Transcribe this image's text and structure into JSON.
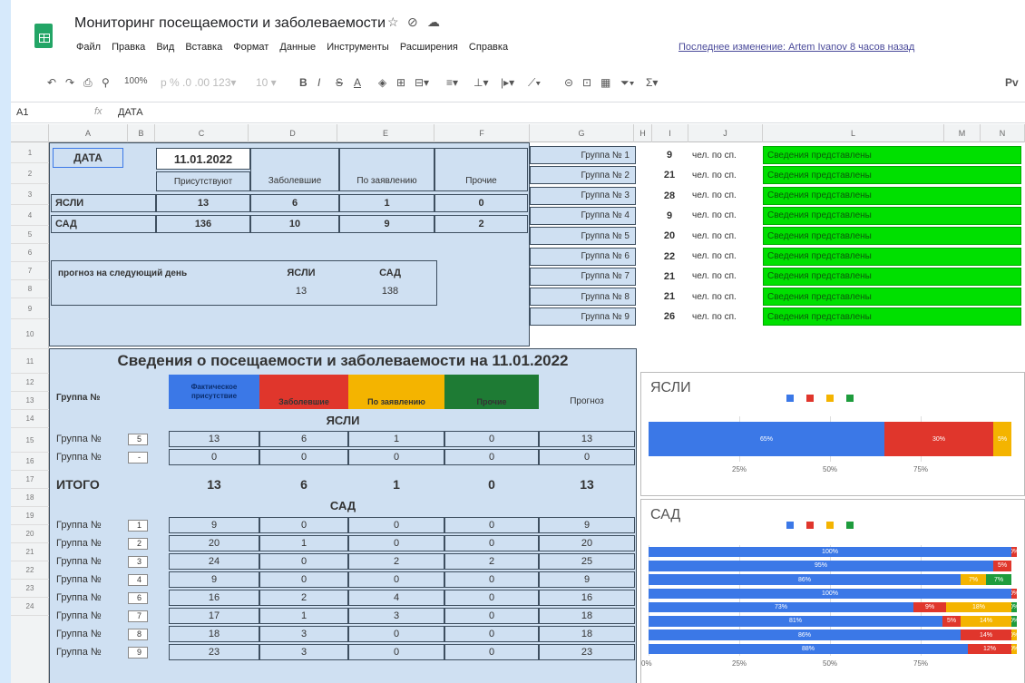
{
  "title": "Мониторинг посещаемости и заболеваемости",
  "menu": [
    "Файл",
    "Правка",
    "Вид",
    "Вставка",
    "Формат",
    "Данные",
    "Инструменты",
    "Расширения",
    "Справка"
  ],
  "last_edit": "Последнее изменение: Artem Ivanov 8 часов назад",
  "toolbar": {
    "zoom": "100%",
    "font": "Pv"
  },
  "formula": {
    "cell": "A1",
    "fx": "fx",
    "value": "ДАТА"
  },
  "columns": [
    "A",
    "B",
    "C",
    "D",
    "E",
    "F",
    "G",
    "H",
    "I",
    "J",
    "L",
    "M",
    "N"
  ],
  "rows": [
    "1",
    "2",
    "3",
    "4",
    "5",
    "6",
    "7",
    "8",
    "9",
    "10",
    "11",
    "12",
    "13",
    "14",
    "15",
    "16",
    "17",
    "18",
    "19",
    "20",
    "21",
    "22",
    "23",
    "24"
  ],
  "top": {
    "date_label": "ДАТА",
    "date": "11.01.2022",
    "h_present": "Присутствуют",
    "h_sick": "Заболевшие",
    "h_request": "По заявлению",
    "h_other": "Прочие",
    "nursery": {
      "label": "ЯСЛИ",
      "present": "13",
      "sick": "6",
      "request": "1",
      "other": "0"
    },
    "kinder": {
      "label": "САД",
      "present": "136",
      "sick": "10",
      "request": "9",
      "other": "2"
    },
    "forecast_label": "прогноз на следующий день",
    "forecast_n_label": "ЯСЛИ",
    "forecast_n": "13",
    "forecast_k_label": "САД",
    "forecast_k": "138"
  },
  "groups": [
    {
      "name": "Группа № 1",
      "n": "9",
      "unit": "чел. по сп.",
      "status": "Сведения представлены"
    },
    {
      "name": "Группа № 2",
      "n": "21",
      "unit": "чел. по сп.",
      "status": "Сведения представлены"
    },
    {
      "name": "Группа № 3",
      "n": "28",
      "unit": "чел. по сп.",
      "status": "Сведения представлены"
    },
    {
      "name": "Группа № 4",
      "n": "9",
      "unit": "чел. по сп.",
      "status": "Сведения представлены"
    },
    {
      "name": "Группа № 5",
      "n": "20",
      "unit": "чел. по сп.",
      "status": "Сведения представлены"
    },
    {
      "name": "Группа № 6",
      "n": "22",
      "unit": "чел. по сп.",
      "status": "Сведения представлены"
    },
    {
      "name": "Группа № 7",
      "n": "21",
      "unit": "чел. по сп.",
      "status": "Сведения представлены"
    },
    {
      "name": "Группа № 8",
      "n": "21",
      "unit": "чел. по сп.",
      "status": "Сведения представлены"
    },
    {
      "name": "Группа № 9",
      "n": "26",
      "unit": "чел. по сп.",
      "status": "Сведения представлены"
    }
  ],
  "table": {
    "title": "Сведения о посещаемости и заболеваемости на 11.01.2022",
    "h_group": "Группа №",
    "h_actual": "Фактическое присутствие",
    "h_sick": "Заболевшие",
    "h_request": "По заявлению",
    "h_other": "Прочие",
    "h_forecast": "Прогноз",
    "colors": {
      "actual": "#3b78e7",
      "sick": "#e0362c",
      "request": "#f4b400",
      "other": "#1e7b34"
    },
    "nursery_label": "ЯСЛИ",
    "nursery_rows": [
      {
        "label": "Группа №",
        "num": "5",
        "actual": "13",
        "sick": "6",
        "request": "1",
        "other": "0",
        "forecast": "13"
      },
      {
        "label": "Группа №",
        "num": "-",
        "actual": "0",
        "sick": "0",
        "request": "0",
        "other": "0",
        "forecast": "0"
      }
    ],
    "total": {
      "label": "ИТОГО",
      "actual": "13",
      "sick": "6",
      "request": "1",
      "other": "0",
      "forecast": "13"
    },
    "kinder_label": "САД",
    "kinder_rows": [
      {
        "label": "Группа №",
        "num": "1",
        "actual": "9",
        "sick": "0",
        "request": "0",
        "other": "0",
        "forecast": "9"
      },
      {
        "label": "Группа №",
        "num": "2",
        "actual": "20",
        "sick": "1",
        "request": "0",
        "other": "0",
        "forecast": "20"
      },
      {
        "label": "Группа №",
        "num": "3",
        "actual": "24",
        "sick": "0",
        "request": "2",
        "other": "2",
        "forecast": "25"
      },
      {
        "label": "Группа №",
        "num": "4",
        "actual": "9",
        "sick": "0",
        "request": "0",
        "other": "0",
        "forecast": "9"
      },
      {
        "label": "Группа №",
        "num": "6",
        "actual": "16",
        "sick": "2",
        "request": "4",
        "other": "0",
        "forecast": "16"
      },
      {
        "label": "Группа №",
        "num": "7",
        "actual": "17",
        "sick": "1",
        "request": "3",
        "other": "0",
        "forecast": "18"
      },
      {
        "label": "Группа №",
        "num": "8",
        "actual": "18",
        "sick": "3",
        "request": "0",
        "other": "0",
        "forecast": "18"
      },
      {
        "label": "Группа №",
        "num": "9",
        "actual": "23",
        "sick": "3",
        "request": "0",
        "other": "0",
        "forecast": "23"
      }
    ]
  },
  "chart_data": [
    {
      "type": "bar",
      "title": "ЯСЛИ",
      "stacked": "percent",
      "orientation": "horizontal",
      "colors": [
        "#3b78e7",
        "#e0362c",
        "#f4b400",
        "#1e9c3d"
      ],
      "rows": [
        {
          "values": [
            65,
            30,
            5,
            0
          ],
          "labels": [
            "65%",
            "30%",
            "5%"
          ]
        }
      ],
      "ticks": [
        "25%",
        "50%",
        "75%"
      ]
    },
    {
      "type": "bar",
      "title": "САД",
      "stacked": "percent",
      "orientation": "horizontal",
      "colors": [
        "#3b78e7",
        "#e0362c",
        "#f4b400",
        "#1e9c3d"
      ],
      "rows": [
        {
          "values": [
            100,
            0,
            0,
            0
          ],
          "labels": [
            "100%",
            "0%"
          ]
        },
        {
          "values": [
            95,
            5,
            0,
            0
          ],
          "labels": [
            "95%",
            "5%"
          ]
        },
        {
          "values": [
            86,
            0,
            7,
            7
          ],
          "labels": [
            "86%",
            "0%",
            "7%",
            "7%"
          ]
        },
        {
          "values": [
            100,
            0,
            0,
            0
          ],
          "labels": [
            "100%",
            "0%"
          ]
        },
        {
          "values": [
            73,
            9,
            18,
            0
          ],
          "labels": [
            "73%",
            "9%",
            "18%",
            "0%"
          ]
        },
        {
          "values": [
            81,
            5,
            14,
            0
          ],
          "labels": [
            "81%",
            "5%",
            "14%",
            "0%"
          ]
        },
        {
          "values": [
            86,
            14,
            0,
            0
          ],
          "labels": [
            "86%",
            "14%",
            "0%"
          ]
        },
        {
          "values": [
            88,
            12,
            0,
            0
          ],
          "labels": [
            "88%",
            "12%",
            "0%"
          ]
        }
      ],
      "ticks": [
        "0%",
        "25%",
        "50%",
        "75%"
      ]
    }
  ]
}
